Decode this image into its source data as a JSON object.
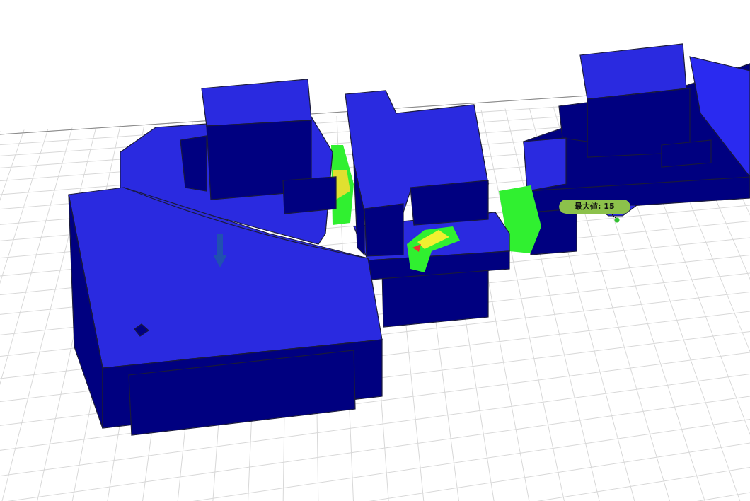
{
  "viewport": {
    "probe_label": {
      "text": "最大値: 15"
    }
  }
}
